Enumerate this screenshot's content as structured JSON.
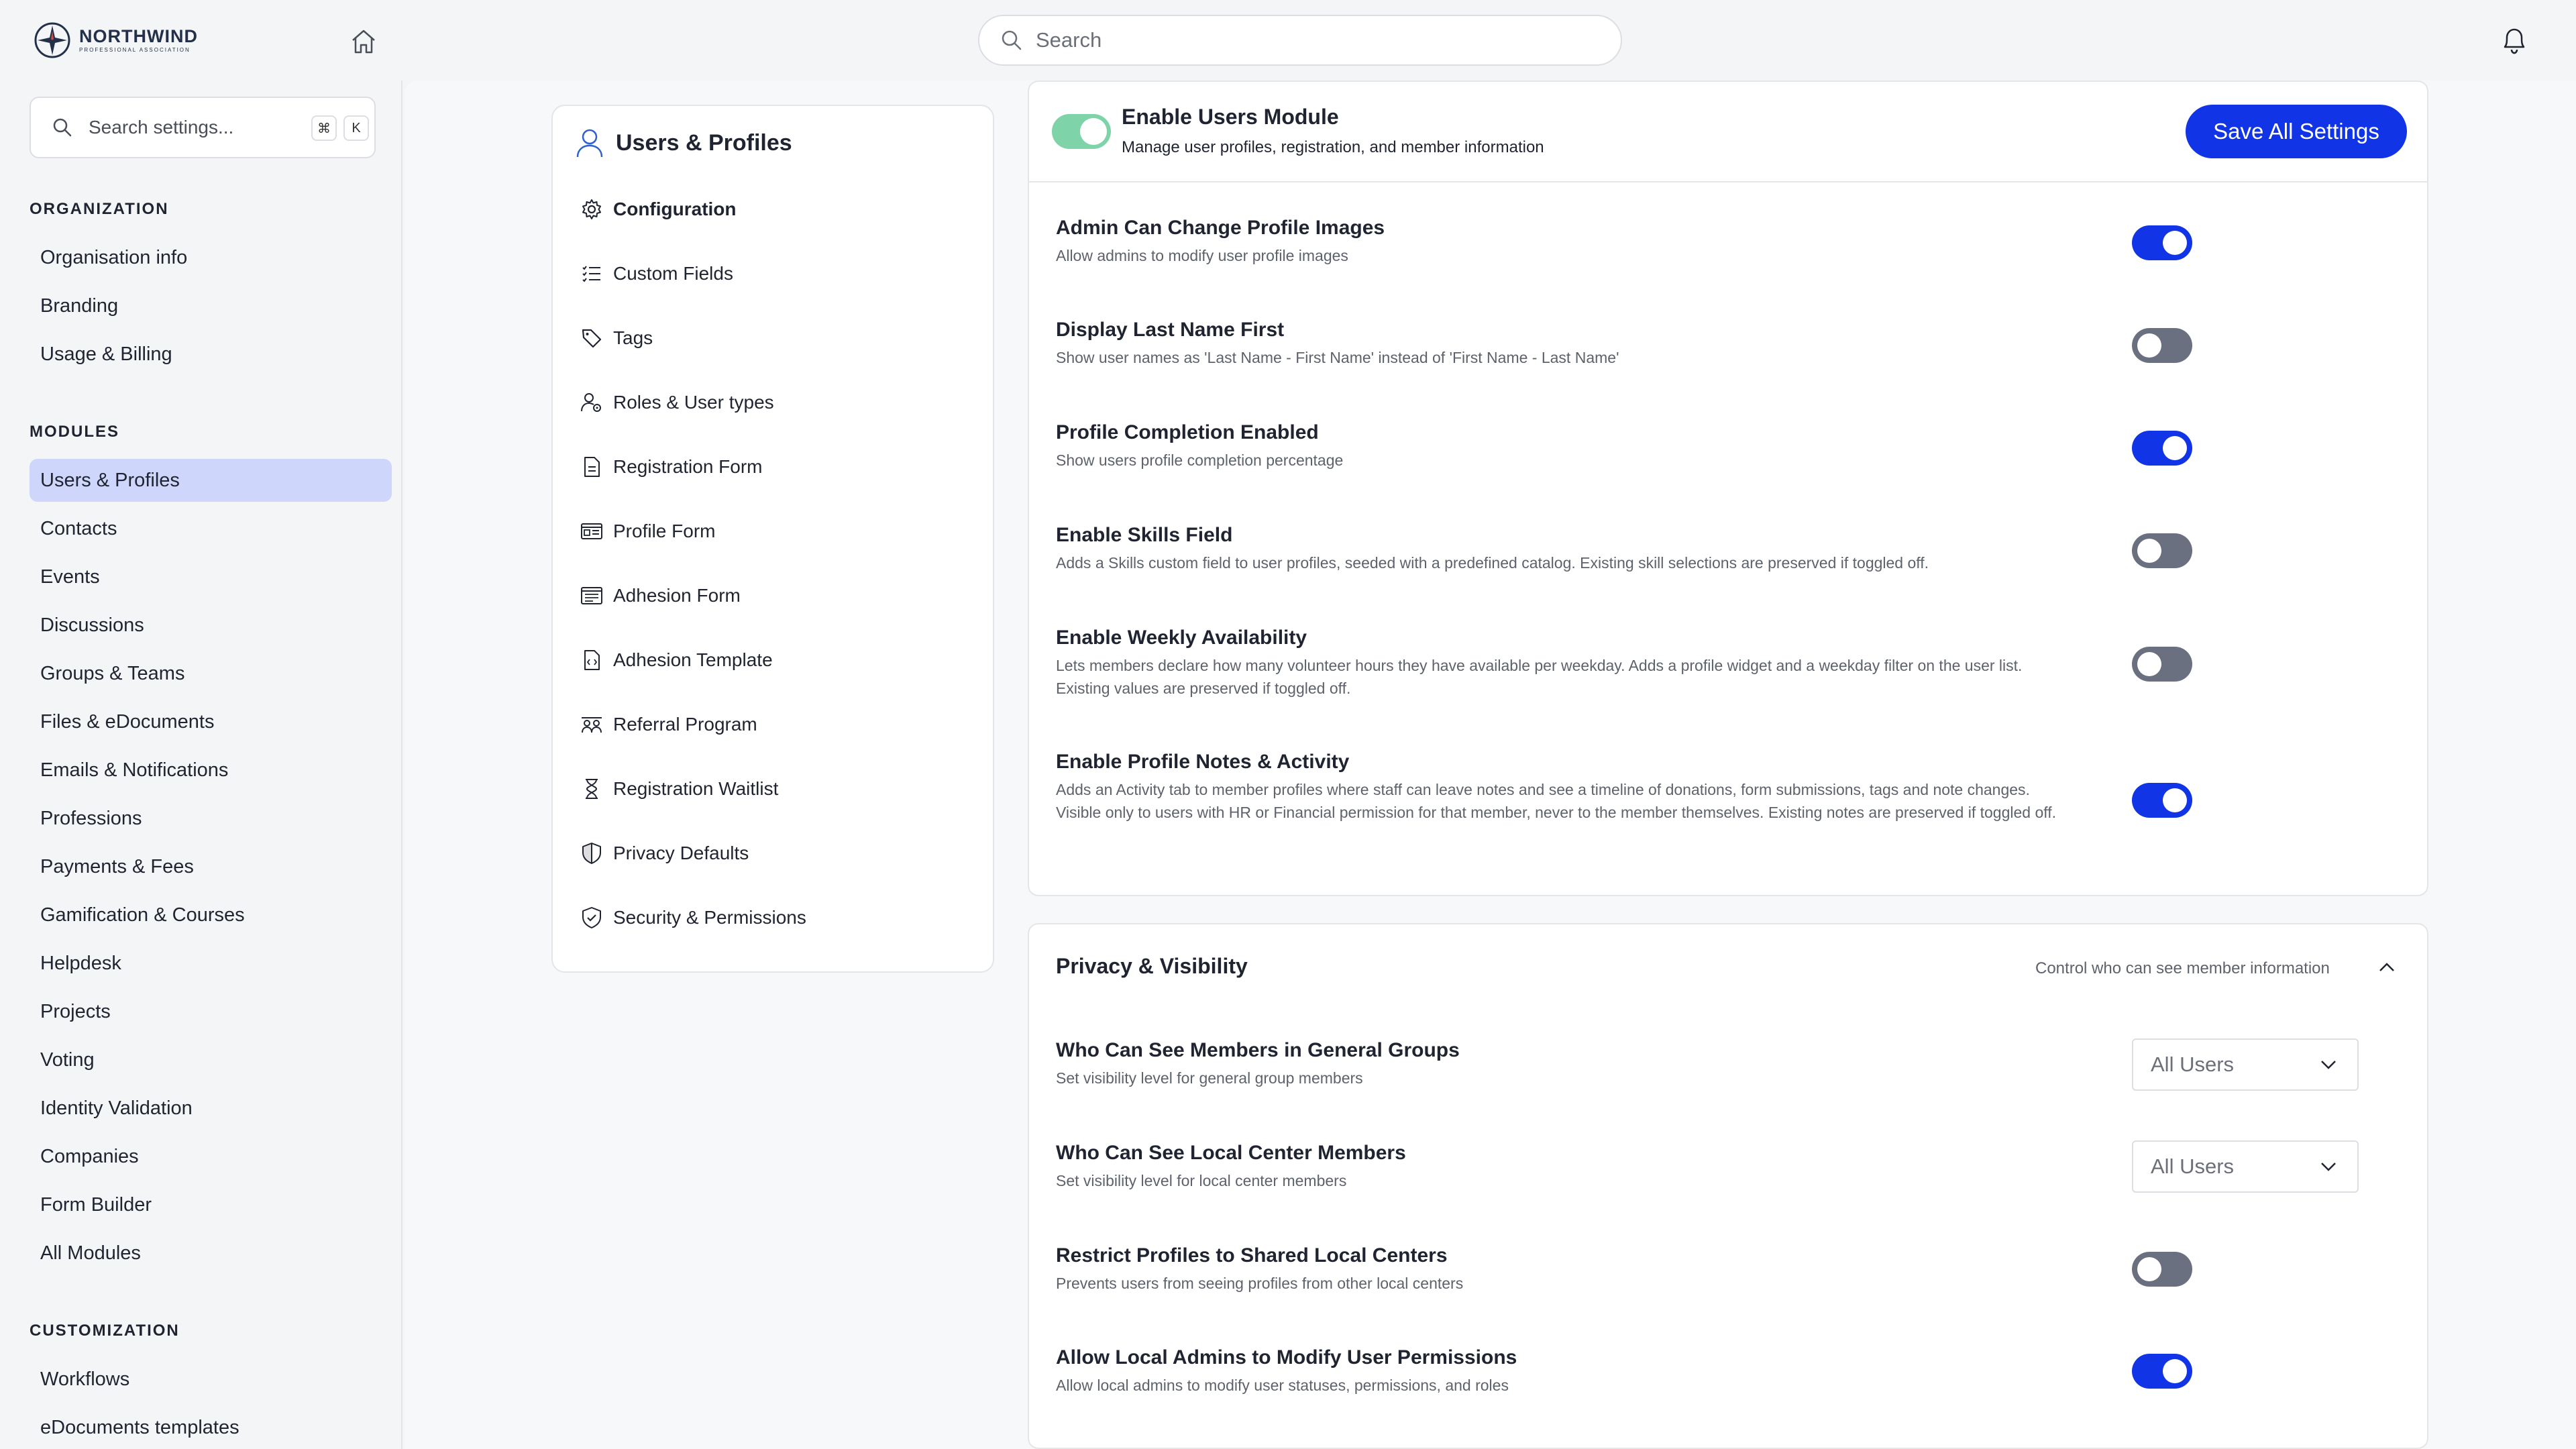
{
  "brand": {
    "name": "NORTHWIND",
    "tagline": "PROFESSIONAL ASSOCIATION"
  },
  "top_search": {
    "placeholder": "Search"
  },
  "sidebar": {
    "search_placeholder": "Search settings...",
    "shortcut_keys": [
      "⌘",
      "K"
    ],
    "sections": [
      {
        "label": "ORGANIZATION",
        "items": [
          "Organisation info",
          "Branding",
          "Usage & Billing"
        ]
      },
      {
        "label": "MODULES",
        "items": [
          "Users & Profiles",
          "Contacts",
          "Events",
          "Discussions",
          "Groups & Teams",
          "Files & eDocuments",
          "Emails & Notifications",
          "Professions",
          "Payments & Fees",
          "Gamification & Courses",
          "Helpdesk",
          "Projects",
          "Voting",
          "Identity Validation",
          "Companies",
          "Form Builder",
          "All Modules"
        ]
      },
      {
        "label": "CUSTOMIZATION",
        "items": [
          "Workflows",
          "eDocuments templates"
        ]
      }
    ],
    "active_item": "Users & Profiles"
  },
  "subnav": {
    "title": "Users & Profiles",
    "items": [
      {
        "label": "Configuration",
        "icon": "gear-icon",
        "active": true
      },
      {
        "label": "Custom Fields",
        "icon": "list-check-icon"
      },
      {
        "label": "Tags",
        "icon": "tag-icon"
      },
      {
        "label": "Roles & User types",
        "icon": "user-roles-icon"
      },
      {
        "label": "Registration Form",
        "icon": "document-icon"
      },
      {
        "label": "Profile Form",
        "icon": "id-card-icon"
      },
      {
        "label": "Adhesion Form",
        "icon": "form-icon"
      },
      {
        "label": "Adhesion Template",
        "icon": "file-code-icon"
      },
      {
        "label": "Referral Program",
        "icon": "people-icon"
      },
      {
        "label": "Registration Waitlist",
        "icon": "hourglass-icon"
      },
      {
        "label": "Privacy Defaults",
        "icon": "shield-half-icon"
      },
      {
        "label": "Security & Permissions",
        "icon": "shield-check-icon"
      }
    ]
  },
  "module": {
    "title": "Enable Users Module",
    "subtitle": "Manage user profiles, registration, and member information",
    "enabled": true,
    "save_label": "Save All Settings"
  },
  "settings": [
    {
      "title": "Admin Can Change Profile Images",
      "desc": "Allow admins to modify user profile images",
      "on": true
    },
    {
      "title": "Display Last Name First",
      "desc": "Show user names as 'Last Name - First Name' instead of 'First Name - Last Name'",
      "on": false
    },
    {
      "title": "Profile Completion Enabled",
      "desc": "Show users profile completion percentage",
      "on": true
    },
    {
      "title": "Enable Skills Field",
      "desc": "Adds a Skills custom field to user profiles, seeded with a predefined catalog. Existing skill selections are preserved if toggled off.",
      "on": false
    },
    {
      "title": "Enable Weekly Availability",
      "desc": "Lets members declare how many volunteer hours they have available per weekday. Adds a profile widget and a weekday filter on the user list. Existing values are preserved if toggled off.",
      "on": false
    },
    {
      "title": "Enable Profile Notes & Activity",
      "desc": "Adds an Activity tab to member profiles where staff can leave notes and see a timeline of donations, form submissions, tags and note changes. Visible only to users with HR or Financial permission for that member, never to the member themselves. Existing notes are preserved if toggled off.",
      "on": true
    }
  ],
  "privacy": {
    "title": "Privacy & Visibility",
    "subtitle": "Control who can see member information",
    "settings": [
      {
        "title": "Who Can See Members in General Groups",
        "desc": "Set visibility level for general group members",
        "type": "select",
        "value": "All Users"
      },
      {
        "title": "Who Can See Local Center Members",
        "desc": "Set visibility level for local center members",
        "type": "select",
        "value": "All Users"
      },
      {
        "title": "Restrict Profiles to Shared Local Centers",
        "desc": "Prevents users from seeing profiles from other local centers",
        "type": "toggle",
        "on": false
      },
      {
        "title": "Allow Local Admins to Modify User Permissions",
        "desc": "Allow local admins to modify user statuses, permissions, and roles",
        "type": "toggle",
        "on": true
      }
    ]
  },
  "colors": {
    "accent": "#1034e6",
    "toggle_off": "#6b7080",
    "module_toggle": "#7fd3a8",
    "active_nav": "#cfd6fb"
  }
}
